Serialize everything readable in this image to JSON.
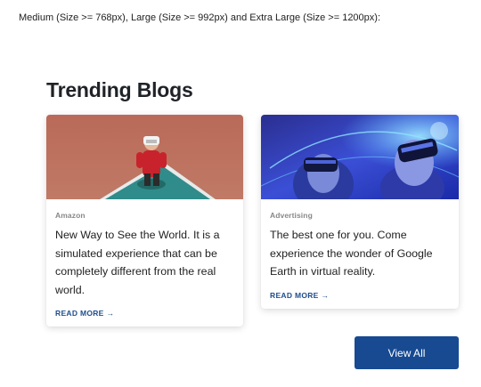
{
  "caption": "Medium (Size >= 768px), Large (Size >= 992px) and Extra Large (Size >= 1200px):",
  "section": {
    "title": "Trending Blogs",
    "view_all_label": "View All"
  },
  "cards": [
    {
      "category": "Amazon",
      "text": "New Way to See the World. It is a simulated experience that can be completely different from the real world.",
      "read_more_label": "READ MORE",
      "arrow": "→"
    },
    {
      "category": "Advertising",
      "text": "The best one for you. Come experience the wonder of Google Earth in virtual reality.",
      "read_more_label": "READ MORE",
      "arrow": "→"
    }
  ],
  "colors": {
    "accent": "#174a91",
    "link": "#1e4d8c",
    "category": "#888888"
  }
}
